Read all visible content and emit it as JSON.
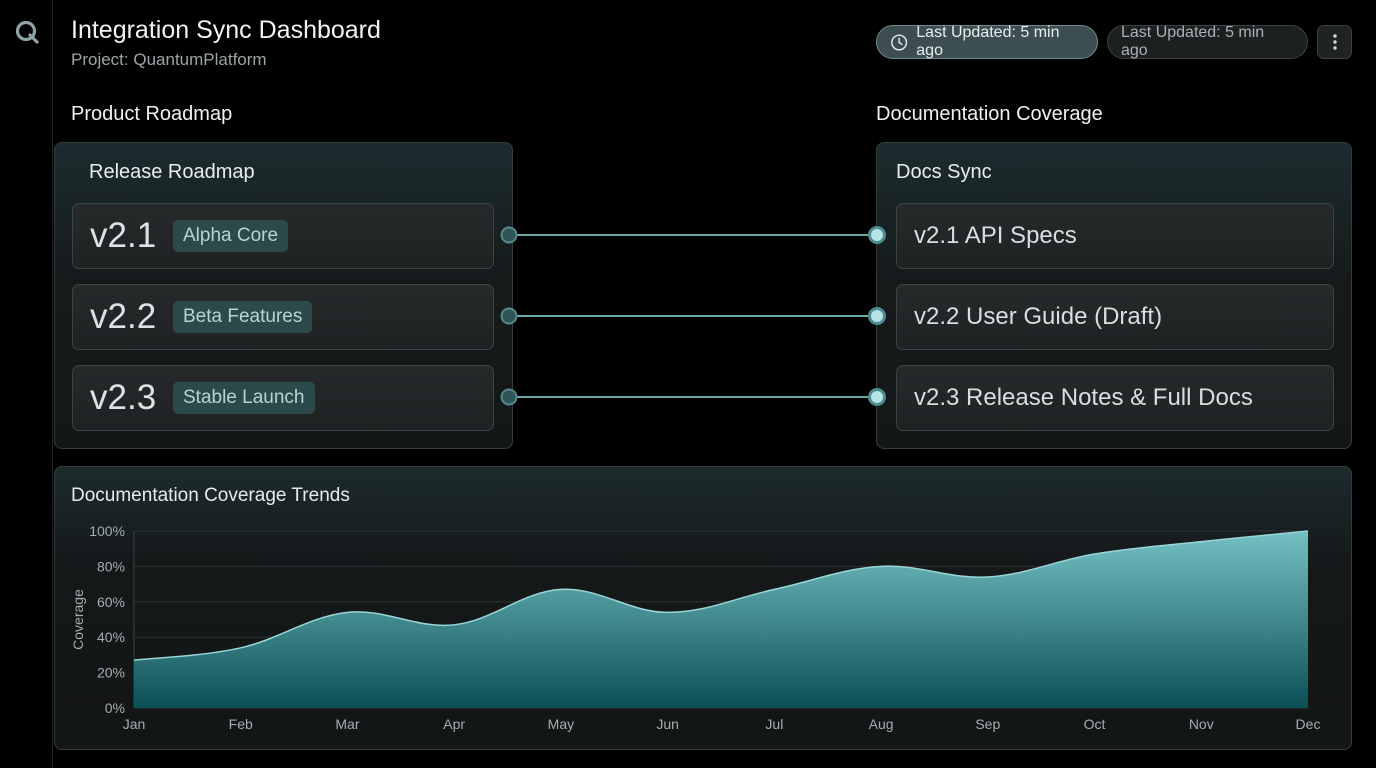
{
  "header": {
    "title": "Integration Sync Dashboard",
    "subtitle": "Project: QuantumPlatform",
    "badges": [
      {
        "label": "Last Updated: 5 min ago",
        "icon": "clock-icon"
      },
      {
        "label": "Last Updated: 5 min ago"
      }
    ],
    "more_icon": "more-vertical-icon"
  },
  "roadmap": {
    "section_title": "Product Roadmap",
    "panel_title": "Release Roadmap",
    "items": [
      {
        "version": "v2.1",
        "tag": "Alpha Core"
      },
      {
        "version": "v2.2",
        "tag": "Beta Features"
      },
      {
        "version": "v2.3",
        "tag": "Stable Launch"
      }
    ]
  },
  "docs": {
    "section_title": "Documentation Coverage",
    "panel_title": "Docs Sync",
    "items": [
      {
        "label": "v2.1 API Specs"
      },
      {
        "label": "v2.2 User Guide (Draft)"
      },
      {
        "label": "v2.3 Release Notes & Full Docs"
      }
    ]
  },
  "colors": {
    "accent": "#5fb8bb",
    "area_top": "#79c9cb",
    "area_bottom": "#0b4f55",
    "connector": "#6ea7aa"
  },
  "chart_data": {
    "type": "area",
    "title": "Documentation Coverage Trends",
    "xlabel": "",
    "ylabel": "Coverage",
    "categories": [
      "Jan",
      "Feb",
      "Mar",
      "Apr",
      "May",
      "Jun",
      "Jul",
      "Aug",
      "Sep",
      "Oct",
      "Nov",
      "Dec"
    ],
    "values": [
      27,
      34,
      54,
      47,
      67,
      54,
      67,
      80,
      74,
      87,
      94,
      100
    ],
    "ylim": [
      0,
      100
    ],
    "yticks": [
      "0%",
      "20%",
      "40%",
      "60%",
      "80%",
      "100%"
    ],
    "grid": true
  }
}
